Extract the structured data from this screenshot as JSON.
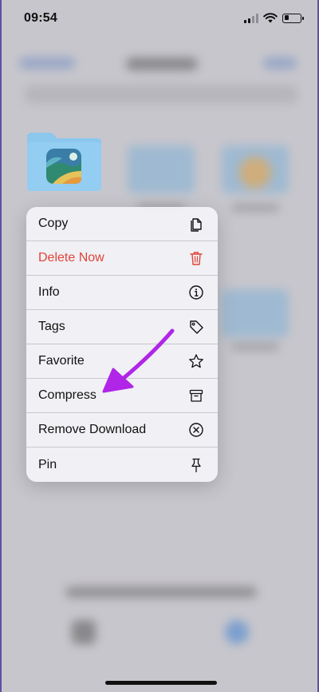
{
  "status_bar": {
    "time": "09:54",
    "battery_level": 0.3
  },
  "context_menu": {
    "items": [
      {
        "label": "Copy",
        "icon": "copy-icon",
        "destructive": false
      },
      {
        "label": "Delete Now",
        "icon": "trash-icon",
        "destructive": true
      },
      {
        "label": "Info",
        "icon": "info-icon",
        "destructive": false
      },
      {
        "label": "Tags",
        "icon": "tag-icon",
        "destructive": false
      },
      {
        "label": "Favorite",
        "icon": "star-icon",
        "destructive": false
      },
      {
        "label": "Compress",
        "icon": "archive-icon",
        "destructive": false
      },
      {
        "label": "Remove Download",
        "icon": "remove-circle-icon",
        "destructive": false
      },
      {
        "label": "Pin",
        "icon": "pin-icon",
        "destructive": false
      }
    ]
  },
  "colors": {
    "destructive": "#e0443a",
    "annotation_arrow": "#b025e8",
    "folder": "#8cc7ee"
  }
}
